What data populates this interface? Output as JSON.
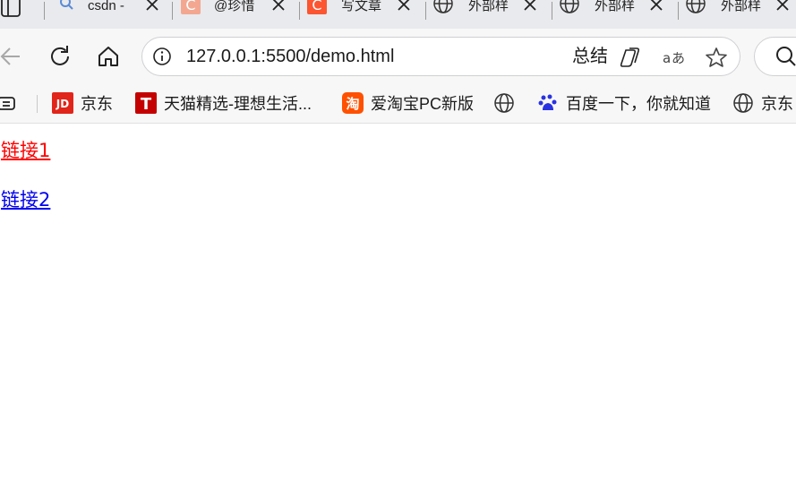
{
  "tabs": [
    {
      "title": "csdn -",
      "favicon": "search-icon",
      "active": true
    },
    {
      "title": "@珍惜",
      "favicon": "csdn-icon"
    },
    {
      "title": "写文章",
      "favicon": "csdn-icon"
    },
    {
      "title": "外部样",
      "favicon": "globe-icon"
    },
    {
      "title": "外部样",
      "favicon": "globe-icon"
    },
    {
      "title": "外部样",
      "favicon": "globe-icon"
    }
  ],
  "toolbar": {
    "url": "127.0.0.1:5500/demo.html",
    "summary_label": "总结"
  },
  "bookmarks": [
    {
      "label": "京东",
      "icon": "jd-icon"
    },
    {
      "label": "天猫精选-理想生活...",
      "icon": "tmall-icon"
    },
    {
      "label": "爱淘宝PC新版",
      "icon": "taobao-icon"
    },
    {
      "label": "",
      "icon": "globe-icon"
    },
    {
      "label": "百度一下，你就知道",
      "icon": "baidu-icon"
    },
    {
      "label": "京东",
      "icon": "globe-icon"
    }
  ],
  "page": {
    "links": [
      {
        "text": "链接1",
        "color": "#ff0000"
      },
      {
        "text": "链接2",
        "color": "#0000ee"
      }
    ]
  },
  "colors": {
    "tabstrip": "#e9eaed",
    "toolbar": "#f7f7f7",
    "csdn": "#fc5531",
    "jd": "#e1251b",
    "tmall": "#c40000",
    "taobao": "#ff5000",
    "baidu": "#2932e1"
  }
}
